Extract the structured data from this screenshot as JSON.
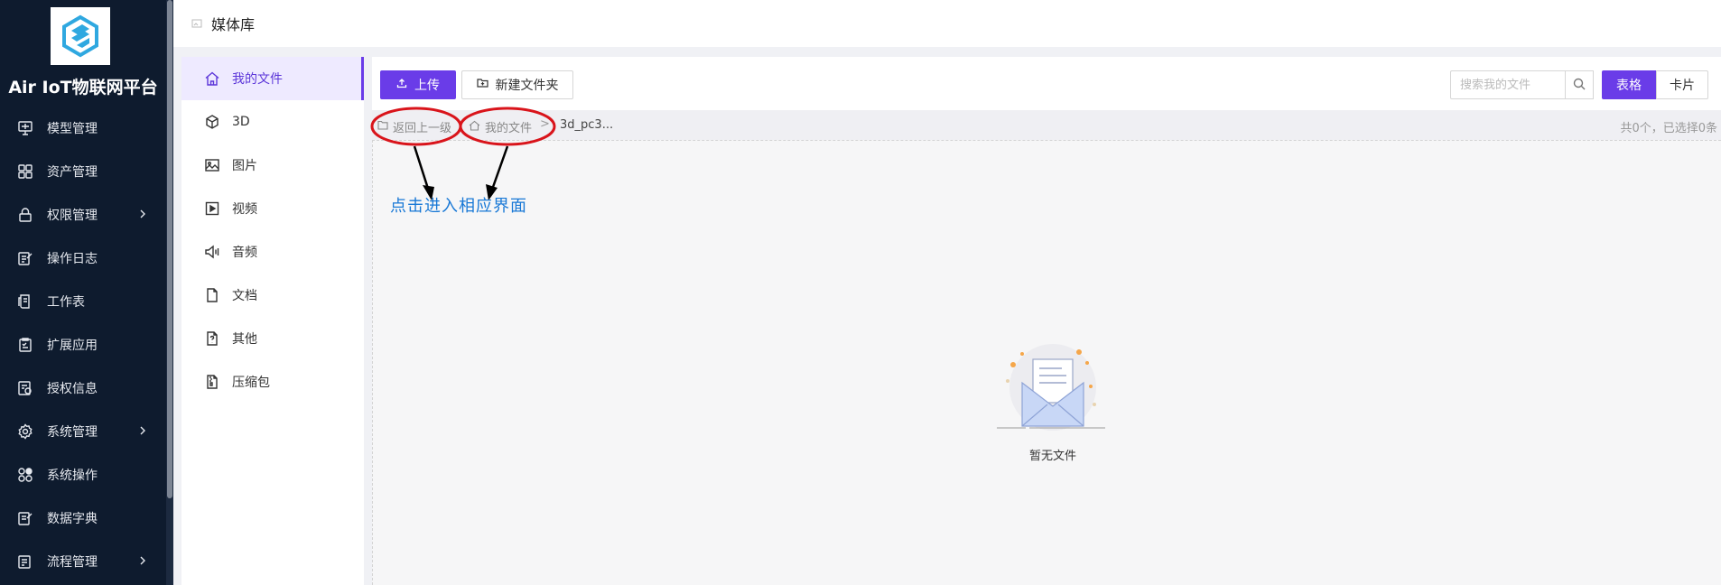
{
  "sidebar": {
    "brand": "Air IoT物联网平台",
    "items": [
      {
        "label": "模型管理",
        "icon": "model-icon",
        "has_children": false
      },
      {
        "label": "资产管理",
        "icon": "grid-icon",
        "has_children": false
      },
      {
        "label": "权限管理",
        "icon": "lock-icon",
        "has_children": true
      },
      {
        "label": "操作日志",
        "icon": "edit-icon",
        "has_children": false
      },
      {
        "label": "工作表",
        "icon": "sheet-icon",
        "has_children": false
      },
      {
        "label": "扩展应用",
        "icon": "checklist-icon",
        "has_children": false
      },
      {
        "label": "授权信息",
        "icon": "license-icon",
        "has_children": false
      },
      {
        "label": "系统管理",
        "icon": "gear-icon",
        "has_children": true
      },
      {
        "label": "系统操作",
        "icon": "apps-icon",
        "has_children": false
      },
      {
        "label": "数据字典",
        "icon": "dictionary-icon",
        "has_children": false
      },
      {
        "label": "流程管理",
        "icon": "flow-icon",
        "has_children": true
      }
    ]
  },
  "header": {
    "title": "媒体库"
  },
  "categories": [
    {
      "label": "我的文件",
      "icon": "home-icon",
      "active": true
    },
    {
      "label": "3D",
      "icon": "cube-icon",
      "active": false
    },
    {
      "label": "图片",
      "icon": "image-icon",
      "active": false
    },
    {
      "label": "视频",
      "icon": "video-icon",
      "active": false
    },
    {
      "label": "音频",
      "icon": "audio-icon",
      "active": false
    },
    {
      "label": "文档",
      "icon": "document-icon",
      "active": false
    },
    {
      "label": "其他",
      "icon": "unknown-file-icon",
      "active": false
    },
    {
      "label": "压缩包",
      "icon": "archive-icon",
      "active": false
    }
  ],
  "toolbar": {
    "upload_label": "上传",
    "new_folder_label": "新建文件夹",
    "search_placeholder": "搜索我的文件",
    "view_table_label": "表格",
    "view_card_label": "卡片"
  },
  "breadcrumb": {
    "back_label": "返回上一级",
    "home_label": "我的文件",
    "separator": ">",
    "current": "3d_pc3...",
    "count_text": "共0个，已选择0条"
  },
  "empty_state": {
    "label": "暂无文件"
  },
  "annotation": {
    "text": "点击进入相应界面"
  },
  "colors": {
    "primary": "#6a3ce8",
    "sidebar_bg": "#0e1b2e",
    "annotation_red": "#d9141b",
    "annotation_blue": "#1878d6"
  }
}
